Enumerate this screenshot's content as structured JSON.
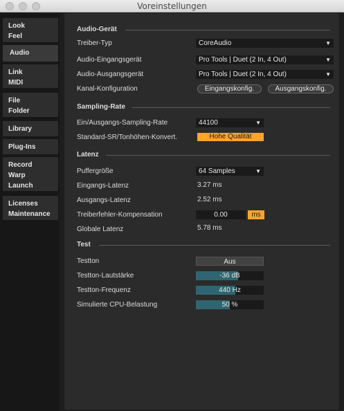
{
  "window": {
    "title": "Voreinstellungen"
  },
  "sidebar": {
    "tabs": [
      {
        "line1": "Look",
        "line2": "Feel",
        "line3": ""
      },
      {
        "line1": "Audio",
        "line2": "",
        "line3": ""
      },
      {
        "line1": "Link",
        "line2": "MIDI",
        "line3": ""
      },
      {
        "line1": "File",
        "line2": "Folder",
        "line3": ""
      },
      {
        "line1": "Library",
        "line2": "",
        "line3": ""
      },
      {
        "line1": "Plug-Ins",
        "line2": "",
        "line3": ""
      },
      {
        "line1": "Record",
        "line2": "Warp",
        "line3": "Launch"
      },
      {
        "line1": "Licenses",
        "line2": "Maintenance",
        "line3": ""
      }
    ],
    "active": "Audio"
  },
  "audio_device": {
    "title": "Audio-Gerät",
    "driver_type_label": "Treiber-Typ",
    "driver_type_value": "CoreAudio",
    "input_device_label": "Audio-Eingangsgerät",
    "input_device_value": "Pro Tools | Duet (2 In, 4 Out)",
    "output_device_label": "Audio-Ausgangsgerät",
    "output_device_value": "Pro Tools | Duet (2 In, 4 Out)",
    "channel_config_label": "Kanal-Konfiguration",
    "input_config_button": "Eingangskonfig.",
    "output_config_button": "Ausgangskonfig."
  },
  "sampling_rate": {
    "title": "Sampling-Rate",
    "io_rate_label": "Ein/Ausgangs-Sampling-Rate",
    "io_rate_value": "44100",
    "src_label": "Standard-SR/Tonhöhen-Konvert.",
    "src_value": "Hohe Qualität"
  },
  "latency": {
    "title": "Latenz",
    "buffer_label": "Puffergröße",
    "buffer_value": "64 Samples",
    "input_latency_label": "Eingangs-Latenz",
    "input_latency_value": "3.27 ms",
    "output_latency_label": "Ausgangs-Latenz",
    "output_latency_value": "2.52 ms",
    "driver_comp_label": "Treiberfehler-Kompensation",
    "driver_comp_value": "0.00",
    "driver_comp_unit": "ms",
    "global_latency_label": "Globale Latenz",
    "global_latency_value": "5.78 ms"
  },
  "test": {
    "title": "Test",
    "test_tone_label": "Testton",
    "test_tone_value": "Aus",
    "volume_label": "Testton-Lautstärke",
    "volume_value": "-36 dB",
    "volume_fraction": 0.62,
    "frequency_label": "Testton-Frequenz",
    "frequency_value": "440 Hz",
    "frequency_fraction": 0.58,
    "cpu_label": "Simulierte CPU-Belastung",
    "cpu_value": "50 %",
    "cpu_fraction": 0.5
  },
  "colors": {
    "accent_orange": "#ffa52c",
    "meter_fill": "#2f6570",
    "panel_bg": "#2b2b2b"
  }
}
